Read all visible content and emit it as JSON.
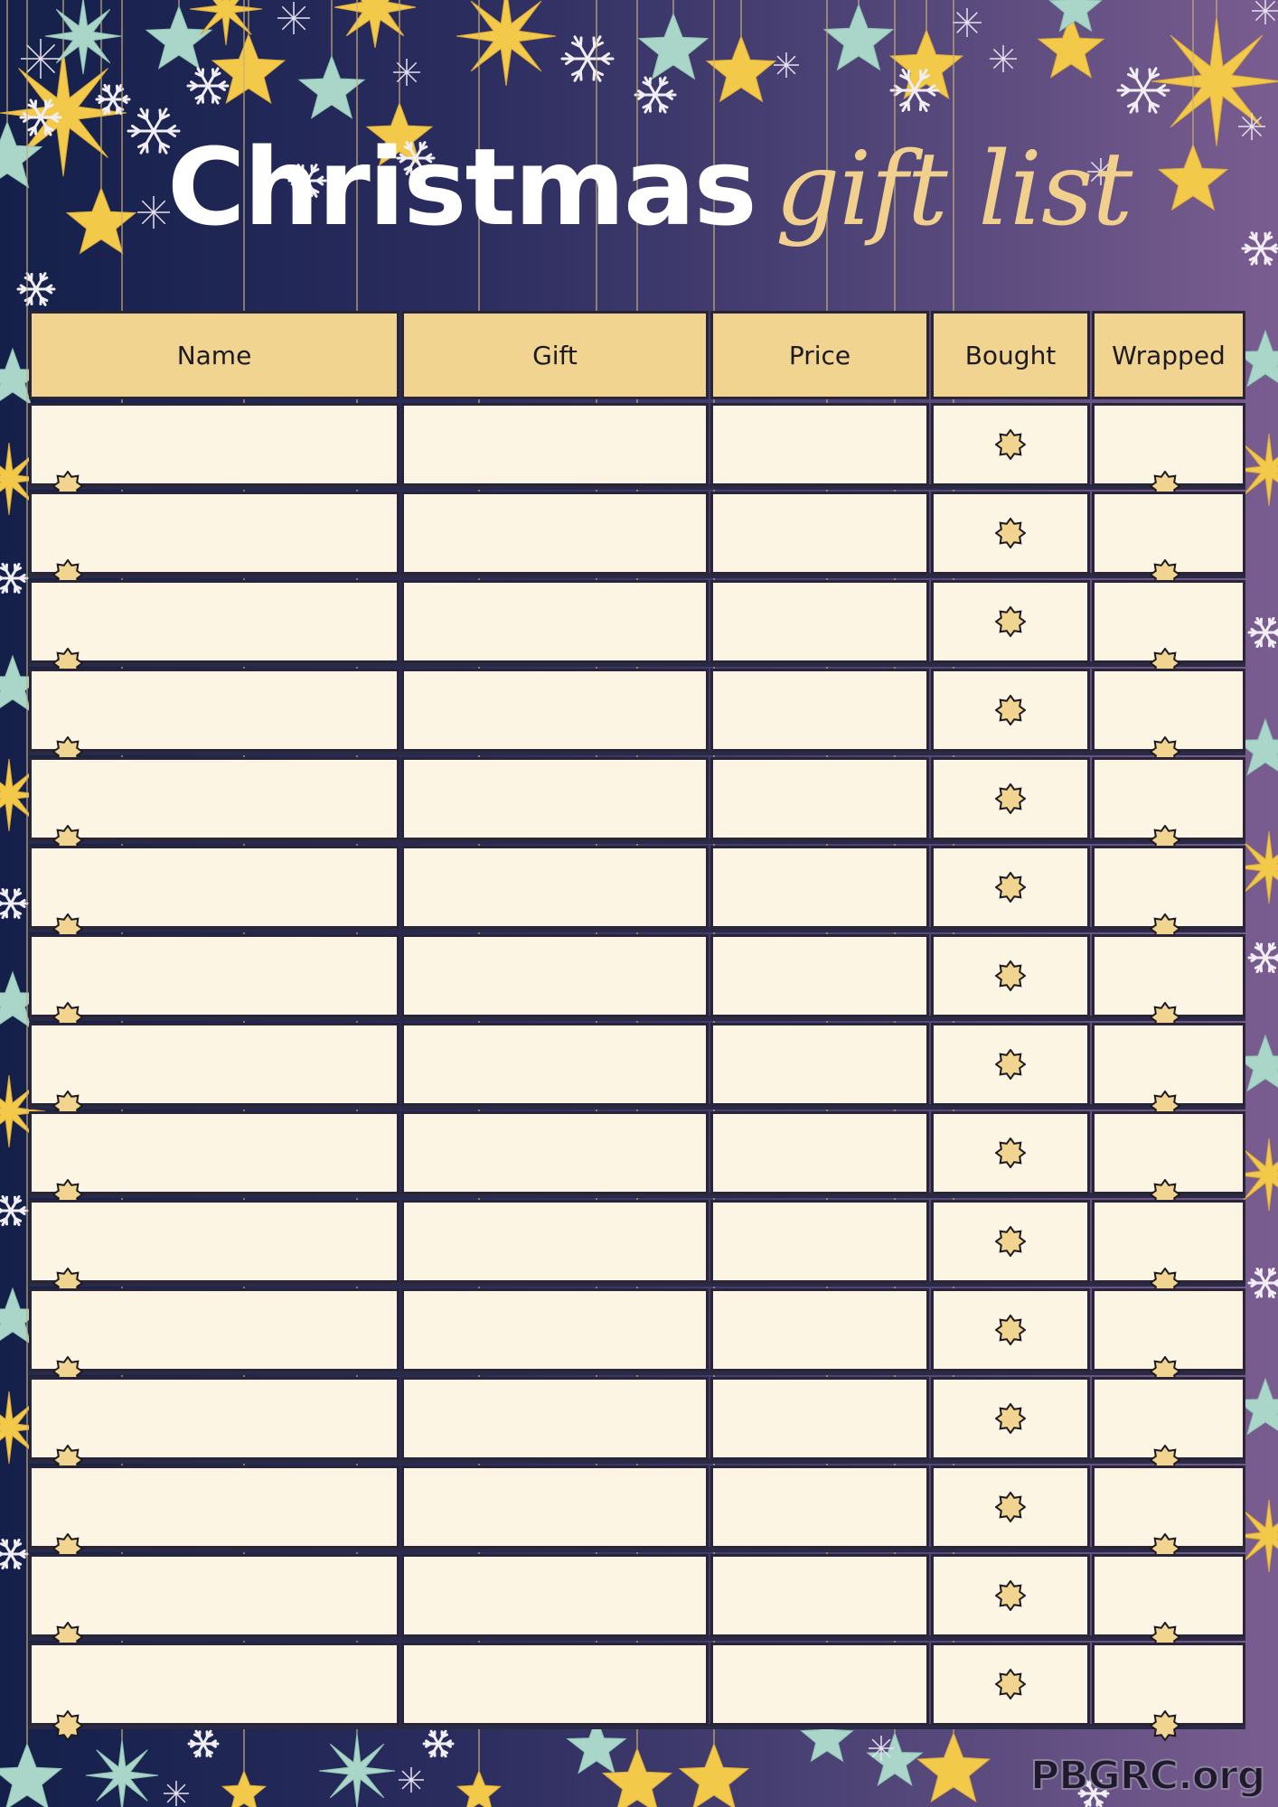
{
  "title": {
    "main": "Christmas",
    "script": "gift list"
  },
  "table": {
    "columns": [
      "Name",
      "Gift",
      "Price",
      "Bought",
      "Wrapped"
    ],
    "row_count": 15,
    "rows": [
      {
        "name": "",
        "gift": "",
        "price": "",
        "bought": false,
        "wrapped": false
      },
      {
        "name": "",
        "gift": "",
        "price": "",
        "bought": false,
        "wrapped": false
      },
      {
        "name": "",
        "gift": "",
        "price": "",
        "bought": false,
        "wrapped": false
      },
      {
        "name": "",
        "gift": "",
        "price": "",
        "bought": false,
        "wrapped": false
      },
      {
        "name": "",
        "gift": "",
        "price": "",
        "bought": false,
        "wrapped": false
      },
      {
        "name": "",
        "gift": "",
        "price": "",
        "bought": false,
        "wrapped": false
      },
      {
        "name": "",
        "gift": "",
        "price": "",
        "bought": false,
        "wrapped": false
      },
      {
        "name": "",
        "gift": "",
        "price": "",
        "bought": false,
        "wrapped": false
      },
      {
        "name": "",
        "gift": "",
        "price": "",
        "bought": false,
        "wrapped": false
      },
      {
        "name": "",
        "gift": "",
        "price": "",
        "bought": false,
        "wrapped": false
      },
      {
        "name": "",
        "gift": "",
        "price": "",
        "bought": false,
        "wrapped": false
      },
      {
        "name": "",
        "gift": "",
        "price": "",
        "bought": false,
        "wrapped": false
      },
      {
        "name": "",
        "gift": "",
        "price": "",
        "bought": false,
        "wrapped": false
      },
      {
        "name": "",
        "gift": "",
        "price": "",
        "bought": false,
        "wrapped": false
      },
      {
        "name": "",
        "gift": "",
        "price": "",
        "bought": false,
        "wrapped": false
      }
    ]
  },
  "decor": {
    "background_icons": [
      "hanging-gold-star-icon",
      "hanging-mint-star-icon",
      "snowflake-icon",
      "sparkle-icon"
    ],
    "checkbox_icon": "eight-point-star-icon"
  },
  "colors": {
    "bg_left": "#14204a",
    "bg_right": "#7a5d90",
    "header_fill": "#f1d48f",
    "cell_fill": "#fcf5e4",
    "border": "#2a2438",
    "title_white": "#ffffff",
    "title_gold": "#f1d08e",
    "gold_star": "#f3c94a",
    "mint_star": "#a9d6c8"
  },
  "watermark": "PBGRC.org"
}
